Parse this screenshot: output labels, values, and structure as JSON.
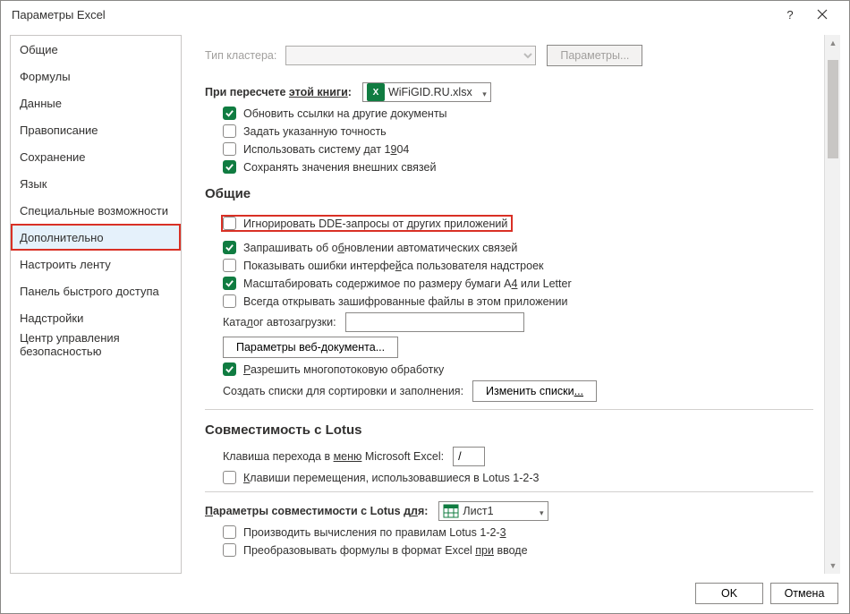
{
  "window": {
    "title": "Параметры Excel"
  },
  "sidebar": {
    "items": [
      {
        "label": "Общие"
      },
      {
        "label": "Формулы"
      },
      {
        "label": "Данные"
      },
      {
        "label": "Правописание"
      },
      {
        "label": "Сохранение"
      },
      {
        "label": "Язык"
      },
      {
        "label": "Специальные возможности"
      },
      {
        "label": "Дополнительно"
      },
      {
        "label": "Настроить ленту"
      },
      {
        "label": "Панель быстрого доступа"
      },
      {
        "label": "Надстройки"
      },
      {
        "label": "Центр управления безопасностью"
      }
    ]
  },
  "cluster": {
    "type_label": "Тип кластера:",
    "params_button": "Параметры..."
  },
  "recalc": {
    "label_prefix": "При пересчете ",
    "label_ul": "этой книги",
    "label_suffix": ":",
    "workbook": "WiFiGID.RU.xlsx",
    "items": {
      "update_links": "Обновить ссылки на другие документы",
      "set_precision": "Задать указанную точность",
      "use_1904": "Использовать систему дат 1904",
      "keep_external": "Сохранять значения внешних связей"
    }
  },
  "general": {
    "heading": "Общие",
    "ignore_dde": "Игнорировать DDE-запросы от других приложений",
    "ask_update": "Запрашивать об обновлении автоматических связей",
    "show_addin_errors": "Показывать ошибки интерфейса пользователя надстроек",
    "scale_a4": "Масштабировать содержимое по размеру бумаги A4 или Letter",
    "always_open_encrypted": "Всегда открывать зашифрованные файлы в этом приложении",
    "autoload_label": "Каталог автозагрузки:",
    "web_options_btn": "Параметры веб-документа...",
    "allow_multithread": "Разрешить многопотоковую обработку",
    "sort_lists_label": "Создать списки для сортировки и заполнения:",
    "edit_lists_btn": "Изменить списки..."
  },
  "lotus": {
    "heading": "Совместимость с Lotus",
    "menu_key_label_prefix": "Клавиша перехода в ",
    "menu_key_ul": "меню",
    "menu_key_suffix": " Microsoft Excel:",
    "menu_key_value": "/",
    "nav_keys": "Клавиши перемещения, использовавшиеся в Lotus 1-2-3"
  },
  "lotus_compat": {
    "label_prefix": "Параметры совместимости с Lotus д",
    "label_ul": "ля",
    "label_suffix": ":",
    "sheet": "Лист1",
    "eval_formulas": "Производить вычисления по правилам Lotus 1-2-3",
    "convert_formulas_prefix": "Преобразовывать формулы в формат Excel ",
    "convert_formulas_ul": "при",
    "convert_formulas_suffix": " вводе"
  },
  "footer": {
    "ok": "OK",
    "cancel": "Отмена"
  }
}
